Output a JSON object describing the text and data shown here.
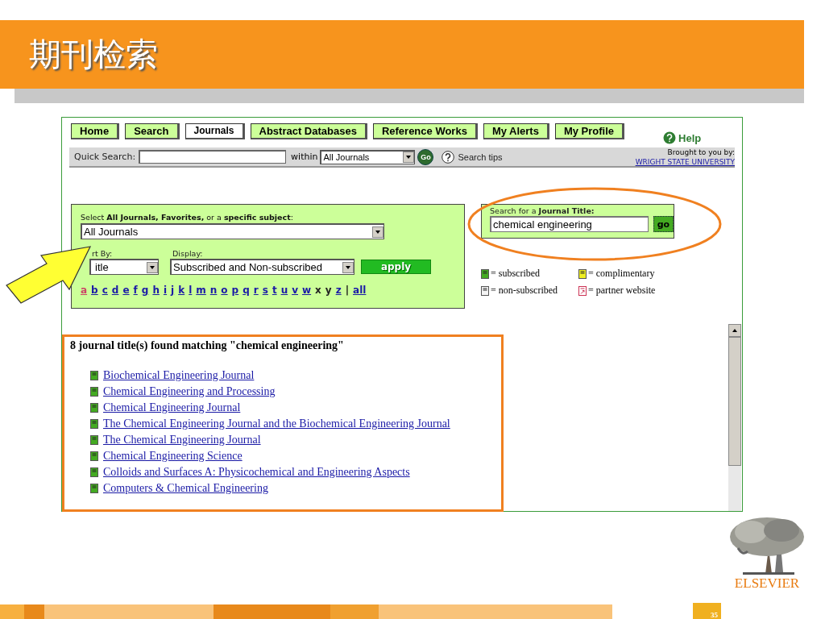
{
  "slide": {
    "title": "期刊检索",
    "logo_text": "ELSEVIER",
    "page_number": "35"
  },
  "nav": {
    "tabs": [
      {
        "label": "Home",
        "selected": false
      },
      {
        "label": "Search",
        "selected": false
      },
      {
        "label": "Journals",
        "selected": true
      },
      {
        "label": "Abstract Databases",
        "selected": false
      },
      {
        "label": "Reference Works",
        "selected": false
      },
      {
        "label": "My Alerts",
        "selected": false
      },
      {
        "label": "My Profile",
        "selected": false
      }
    ],
    "help": "Help"
  },
  "quick_search": {
    "label": "Quick Search:",
    "within_label": "within",
    "within_value": "All Journals",
    "go": "Go",
    "tips": "Search tips",
    "brought_by": "Brought to you by:",
    "institution": "WRIGHT STATE UNIVERSITY"
  },
  "browse": {
    "prompt": "Select **All Journals, Favorites,** or a **specific subject**:",
    "subject": "All Journals",
    "sort_label": "rt By:",
    "sort_value": "itle",
    "display_label": "Display:",
    "display_value": "Subscribed and Non-subscribed",
    "apply": "apply",
    "letters": [
      {
        "label": "a",
        "selected": true,
        "disabled": false
      },
      {
        "label": "b",
        "selected": false,
        "disabled": false
      },
      {
        "label": "c",
        "selected": false,
        "disabled": false
      },
      {
        "label": "d",
        "selected": false,
        "disabled": false
      },
      {
        "label": "e",
        "selected": false,
        "disabled": false
      },
      {
        "label": "f",
        "selected": false,
        "disabled": false
      },
      {
        "label": "g",
        "selected": false,
        "disabled": false
      },
      {
        "label": "h",
        "selected": false,
        "disabled": false
      },
      {
        "label": "i",
        "selected": false,
        "disabled": false
      },
      {
        "label": "j",
        "selected": false,
        "disabled": false
      },
      {
        "label": "k",
        "selected": false,
        "disabled": false
      },
      {
        "label": "l",
        "selected": false,
        "disabled": false
      },
      {
        "label": "m",
        "selected": false,
        "disabled": false
      },
      {
        "label": "n",
        "selected": false,
        "disabled": false
      },
      {
        "label": "o",
        "selected": false,
        "disabled": false
      },
      {
        "label": "p",
        "selected": false,
        "disabled": false
      },
      {
        "label": "q",
        "selected": false,
        "disabled": false
      },
      {
        "label": "r",
        "selected": false,
        "disabled": false
      },
      {
        "label": "s",
        "selected": false,
        "disabled": false
      },
      {
        "label": "t",
        "selected": false,
        "disabled": false
      },
      {
        "label": "u",
        "selected": false,
        "disabled": false
      },
      {
        "label": "v",
        "selected": false,
        "disabled": false
      },
      {
        "label": "w",
        "selected": false,
        "disabled": false
      },
      {
        "label": "x",
        "selected": false,
        "disabled": true
      },
      {
        "label": "y",
        "selected": false,
        "disabled": true
      },
      {
        "label": "z",
        "selected": false,
        "disabled": false
      }
    ],
    "separator": "|",
    "all_link": "all"
  },
  "title_search": {
    "label": "Search for a **Journal Title:**",
    "value": "chemical engineering",
    "go": "go"
  },
  "legend": [
    {
      "kind": "book",
      "color": "#44aa22",
      "label": "= subscribed"
    },
    {
      "kind": "book",
      "color": "#eeee22",
      "label": "= complimentary"
    },
    {
      "kind": "book",
      "color": "#f4f4f4",
      "label": "= non-subscribed"
    },
    {
      "kind": "partner",
      "color": "#cc3355",
      "label": "= partner website"
    }
  ],
  "results": {
    "summary": "8 journal title(s) found matching \"chemical engineering\"",
    "items": [
      {
        "title": "Biochemical Engineering Journal",
        "subscribed": true
      },
      {
        "title": "Chemical Engineering and Processing",
        "subscribed": true
      },
      {
        "title": "Chemical Engineering Journal",
        "subscribed": true
      },
      {
        "title": "The Chemical Engineering Journal and the Biochemical Engineering Journal",
        "subscribed": true
      },
      {
        "title": "The Chemical Engineering Journal",
        "subscribed": true
      },
      {
        "title": "Chemical Engineering Science",
        "subscribed": true
      },
      {
        "title": "Colloids and Surfaces A: Physicochemical and Engineering Aspects",
        "subscribed": true
      },
      {
        "title": "Computers & Chemical Engineering",
        "subscribed": true
      }
    ]
  }
}
